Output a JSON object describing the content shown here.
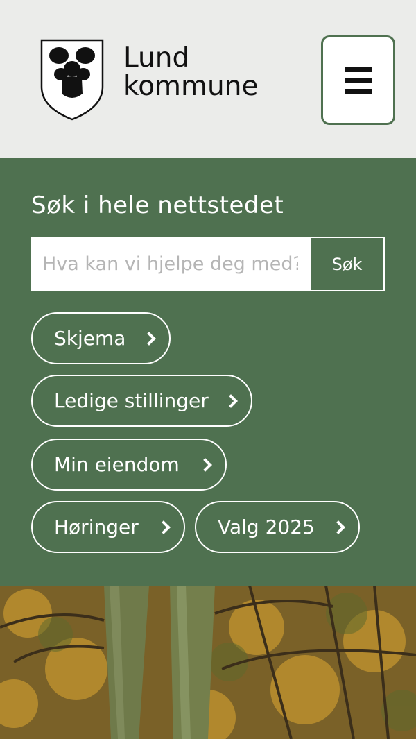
{
  "header": {
    "logo_line1": "Lund",
    "logo_line2": "kommune",
    "menu_icon": "hamburger-menu-icon"
  },
  "search": {
    "heading": "Søk i hele nettstedet",
    "placeholder": "Hva kan vi hjelpe deg med?",
    "button_label": "Søk"
  },
  "quick_links": [
    {
      "label": "Skjema"
    },
    {
      "label": "Ledige stillinger"
    },
    {
      "label": "Min eiendom"
    },
    {
      "label": "Høringer"
    },
    {
      "label": "Valg 2025"
    }
  ],
  "colors": {
    "header_bg": "#ebecea",
    "brand_green": "#4f7150",
    "text_dark": "#111111"
  }
}
